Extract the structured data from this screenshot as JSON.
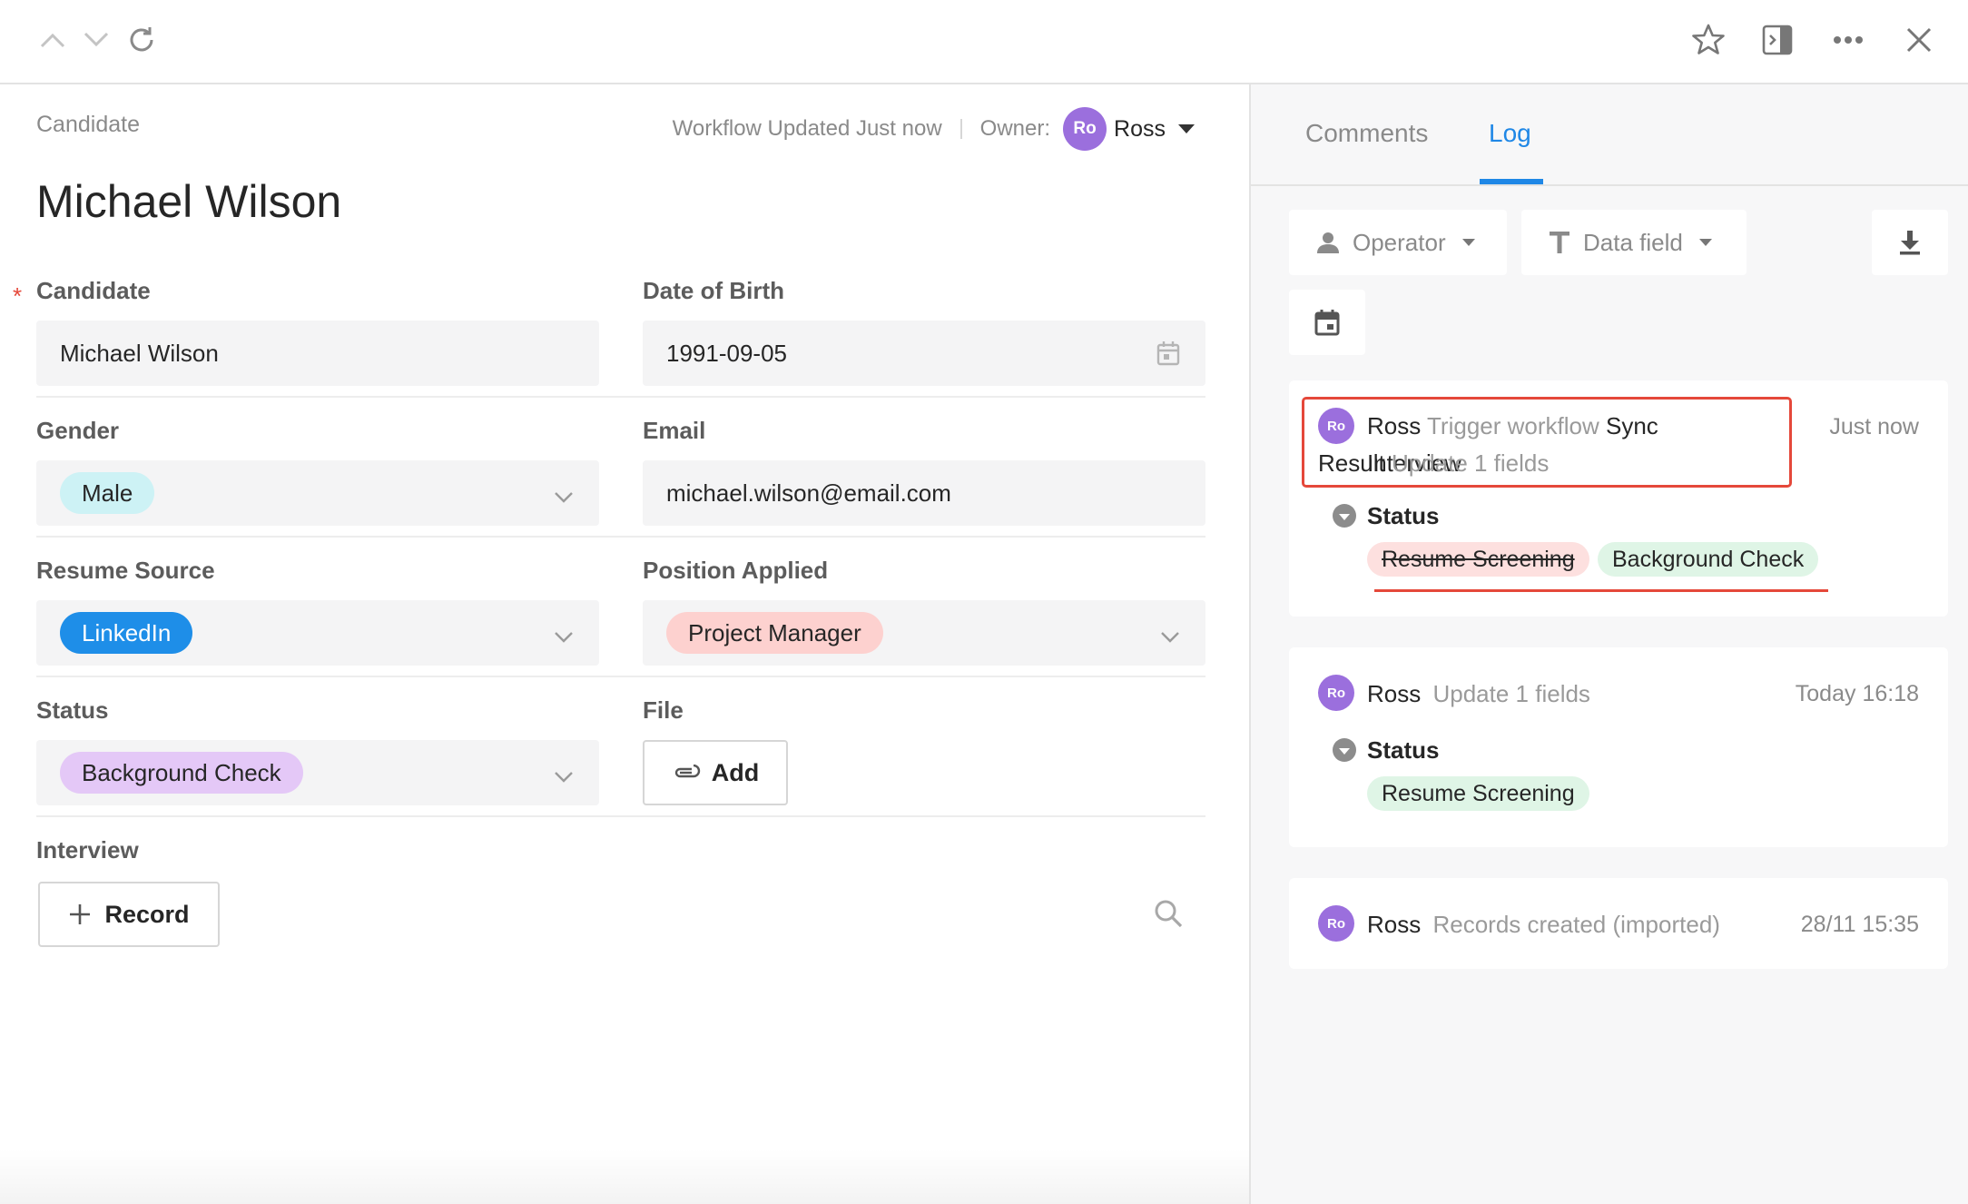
{
  "toolbar": {
    "icons": [
      "chevron-up-icon",
      "chevron-down-icon",
      "refresh-icon",
      "star-icon",
      "panel-toggle-icon",
      "more-icon",
      "close-icon"
    ]
  },
  "record": {
    "breadcrumb": "Candidate",
    "workflow_status": "Workflow Updated Just now",
    "owner_label": "Owner:",
    "owner_initials": "Ro",
    "owner_name": "Ross",
    "title": "Michael Wilson"
  },
  "fields": {
    "candidate": {
      "label": "Candidate",
      "value": "Michael Wilson",
      "required": "*"
    },
    "dob": {
      "label": "Date of Birth",
      "value": "1991-09-05"
    },
    "gender": {
      "label": "Gender",
      "value": "Male"
    },
    "email": {
      "label": "Email",
      "value": "michael.wilson@email.com"
    },
    "resume_source": {
      "label": "Resume Source",
      "value": "LinkedIn"
    },
    "position": {
      "label": "Position Applied",
      "value": "Project Manager"
    },
    "status": {
      "label": "Status",
      "value": "Background Check"
    },
    "file": {
      "label": "File",
      "button": "Add"
    },
    "interview": {
      "label": "Interview",
      "button": "Record"
    }
  },
  "panel": {
    "tabs": {
      "comments": "Comments",
      "log": "Log"
    },
    "filters": {
      "operator": "Operator",
      "data_field": "Data field"
    },
    "logs": [
      {
        "initials": "Ro",
        "user": "Ross",
        "action": "Trigger workflow",
        "workflow_line1": "Sync Interview",
        "workflow_line2": "Result",
        "detail": "Update 1 fields",
        "time": "Just now",
        "field": "Status",
        "old_value": "Resume Screening",
        "new_value": "Background Check"
      },
      {
        "initials": "Ro",
        "user": "Ross",
        "detail": "Update 1 fields",
        "time": "Today 16:18",
        "field": "Status",
        "new_value": "Resume Screening"
      },
      {
        "initials": "Ro",
        "user": "Ross",
        "detail": "Records created (imported)",
        "time": "28/11 15:35"
      }
    ]
  },
  "colors": {
    "accent": "#1f87e6",
    "highlight": "#e5483a",
    "avatar": "#9b6fdd"
  }
}
